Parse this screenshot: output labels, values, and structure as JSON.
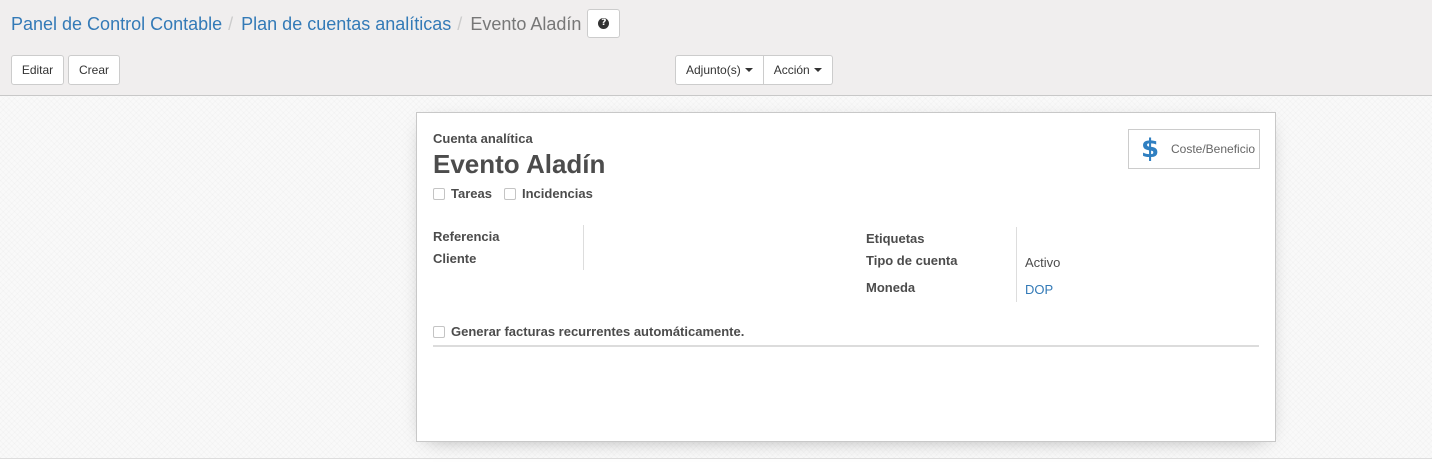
{
  "breadcrumb": {
    "item1": "Panel de Control Contable",
    "item2": "Plan de cuentas analíticas",
    "current": "Evento Aladín",
    "separator": "/"
  },
  "toolbar": {
    "edit_label": "Editar",
    "create_label": "Crear",
    "attachments_label": "Adjunto(s)",
    "action_label": "Acción"
  },
  "form": {
    "header_label": "Cuenta analítica",
    "name": "Evento Aladín",
    "smart_button": {
      "icon": "dollar-icon",
      "glyph": "$",
      "label": "Coste/Beneficio"
    },
    "checks": {
      "tasks": "Tareas",
      "issues": "Incidencias",
      "recurring": "Generar facturas recurrentes automáticamente."
    },
    "fields": {
      "reference_label": "Referencia",
      "customer_label": "Cliente",
      "tags_label": "Etiquetas",
      "account_type_label": "Tipo de cuenta",
      "account_type_value": "Activo",
      "currency_label": "Moneda",
      "currency_value": "DOP"
    }
  },
  "colors": {
    "link": "#337ab7",
    "accent_icon": "#2f7fc1",
    "panel_bg": "#f0eeee"
  }
}
